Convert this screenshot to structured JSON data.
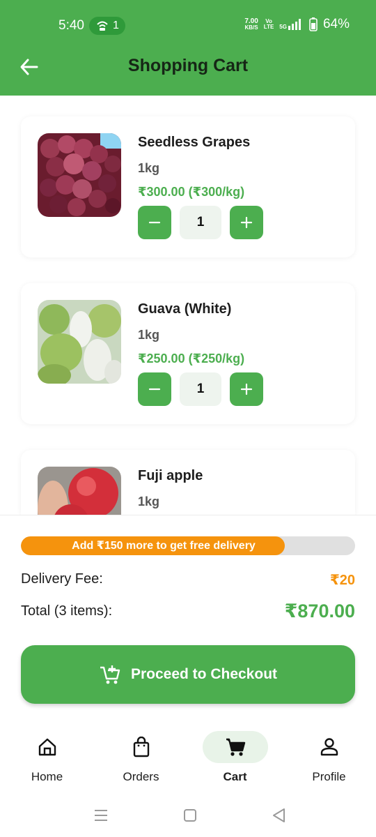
{
  "status_bar": {
    "time": "5:40",
    "hotspot_count": "1",
    "speed_value": "7.00",
    "speed_unit": "KB/S",
    "volte_top": "Vo",
    "volte_bottom": "LTE",
    "network": "5G",
    "battery": "64%"
  },
  "app_bar": {
    "title": "Shopping Cart"
  },
  "cart_items": [
    {
      "name": "Seedless Grapes",
      "weight": "1kg",
      "price": "₹300.00 (₹300/kg)",
      "quantity": "1"
    },
    {
      "name": "Guava (White)",
      "weight": "1kg",
      "price": "₹250.00 (₹250/kg)",
      "quantity": "1"
    },
    {
      "name": "Fuji apple",
      "weight": "1kg"
    }
  ],
  "summary": {
    "free_delivery_message": "Add ₹150 more to get free delivery",
    "free_delivery_progress": 0.79,
    "delivery_fee_label": "Delivery Fee:",
    "delivery_fee_value": "₹20",
    "total_label": "Total (3 items):",
    "total_value": "₹870.00",
    "checkout_label": "Proceed to Checkout"
  },
  "bottom_nav": [
    {
      "label": "Home",
      "icon": "home-icon"
    },
    {
      "label": "Orders",
      "icon": "shopping-bag-icon"
    },
    {
      "label": "Cart",
      "icon": "cart-icon",
      "active": true
    },
    {
      "label": "Profile",
      "icon": "person-icon"
    }
  ],
  "colors": {
    "primary": "#4cae4f",
    "accent_orange": "#f5930d",
    "active_nav_bg": "#e8f3e8"
  }
}
